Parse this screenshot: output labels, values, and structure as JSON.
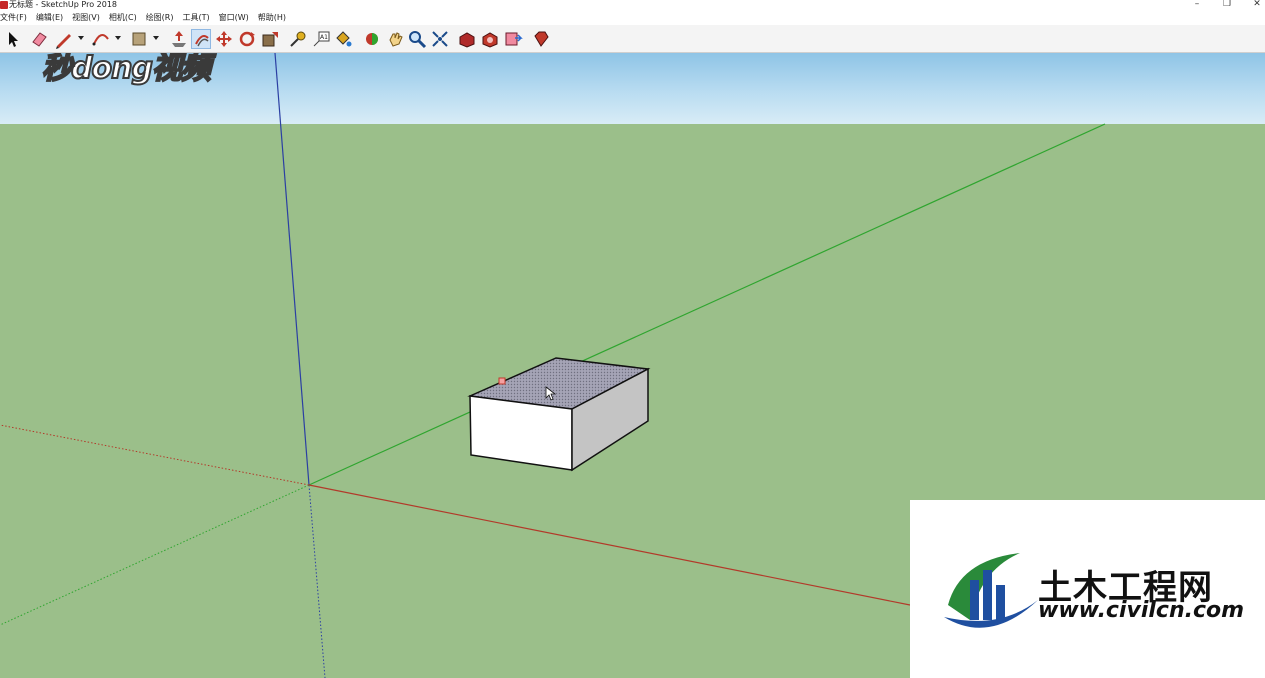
{
  "window": {
    "title": "无标题 - SketchUp Pro 2018",
    "minimize_glyph": "–",
    "restore_glyph": "❐",
    "close_glyph": "✕"
  },
  "menu": [
    "文件(F)",
    "编辑(E)",
    "视图(V)",
    "相机(C)",
    "绘图(R)",
    "工具(T)",
    "窗口(W)",
    "帮助(H)"
  ],
  "toolbar": {
    "tools": [
      {
        "name": "select-tool",
        "icon": "arrow-cursor-icon"
      },
      {
        "name": "eraser-tool",
        "icon": "eraser-icon"
      },
      {
        "name": "line-tool",
        "icon": "pencil-line-icon"
      },
      {
        "name": "arc-tool",
        "icon": "arc-icon"
      },
      {
        "name": "shapes-tool",
        "icon": "rectangle-icon"
      },
      {
        "name": "push-pull-tool",
        "icon": "push-pull-icon"
      },
      {
        "name": "offset-tool",
        "icon": "offset-icon"
      },
      {
        "name": "move-tool",
        "icon": "move-icon"
      },
      {
        "name": "rotate-tool",
        "icon": "rotate-icon"
      },
      {
        "name": "scale-tool",
        "icon": "scale-icon"
      },
      {
        "name": "tape-measure-tool",
        "icon": "tape-measure-icon"
      },
      {
        "name": "text-tool",
        "icon": "text-icon"
      },
      {
        "name": "paint-bucket-tool",
        "icon": "paint-bucket-icon"
      },
      {
        "name": "orbit-tool",
        "icon": "orbit-icon"
      },
      {
        "name": "pan-tool",
        "icon": "hand-icon"
      },
      {
        "name": "zoom-tool",
        "icon": "magnifier-icon"
      },
      {
        "name": "zoom-extents-tool",
        "icon": "zoom-extents-icon"
      },
      {
        "name": "3d-warehouse",
        "icon": "warehouse-icon"
      },
      {
        "name": "extension-warehouse",
        "icon": "extension-icon"
      },
      {
        "name": "send-to-layout",
        "icon": "layout-icon"
      },
      {
        "name": "extension-manager",
        "icon": "ruby-icon"
      }
    ],
    "text_icon_label": "A1"
  },
  "watermarks": {
    "top_left": "秒dong视频",
    "bottom_right_name": "土木工程网",
    "bottom_right_url": "www.civilcn.com"
  },
  "colors": {
    "sky_top": "#8ec4e6",
    "ground": "#9bbf8a",
    "axis_red": "#b23a2a",
    "axis_green": "#2fa52f",
    "axis_blue": "#2b3fa3",
    "box_top": "#a09fb0",
    "box_front": "#ffffff",
    "box_side": "#c4c4c4"
  }
}
